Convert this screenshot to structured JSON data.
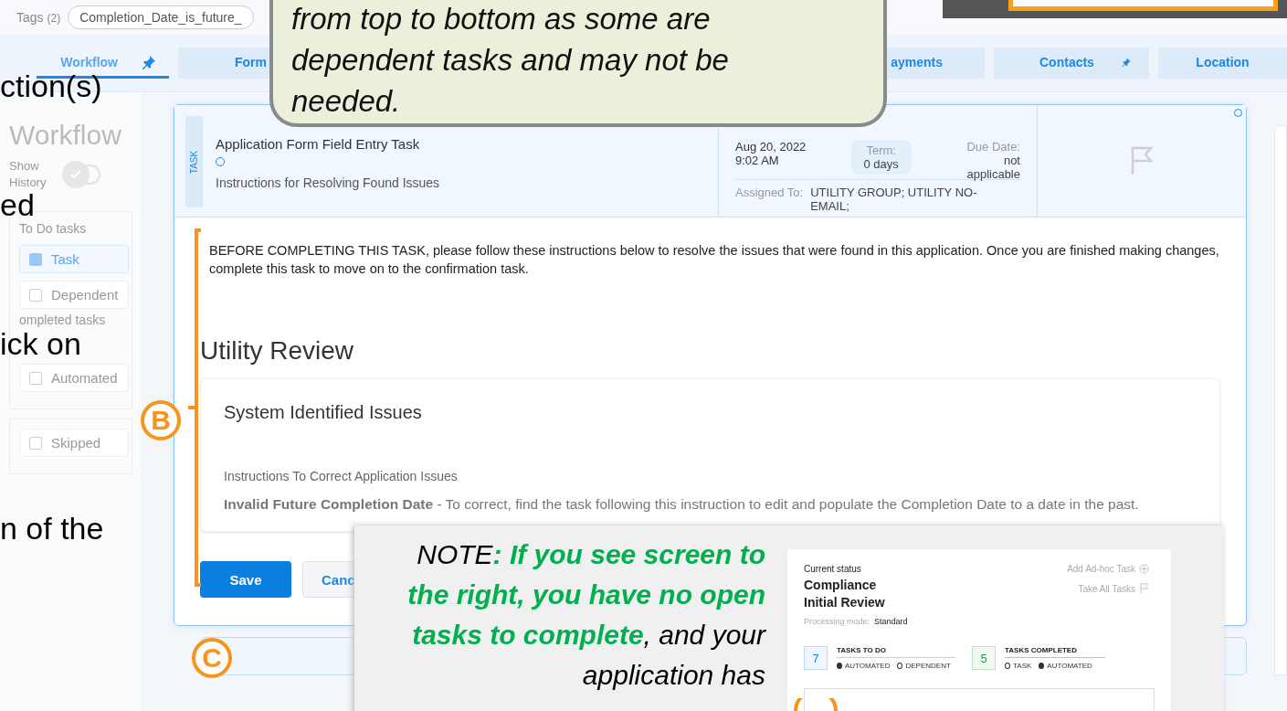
{
  "slide_text": [
    "ction(s)",
    "ed",
    "ick on",
    "n of the"
  ],
  "tags": {
    "label": "Tags",
    "count": "(2)",
    "chip": "Completion_Date_is_future_"
  },
  "tabs": [
    {
      "label": "Workflow",
      "selected": true,
      "pinned": true
    },
    {
      "label": "Form",
      "selected": false
    },
    {
      "label": "ayments",
      "selected": false
    },
    {
      "label": "Contacts",
      "selected": false,
      "pinned": true
    },
    {
      "label": "Location",
      "selected": false,
      "pinned": false
    }
  ],
  "workflow_panel": {
    "title": "Workflow",
    "show_history_label": "Show History",
    "show_history": false,
    "todo_heading": "To Do tasks",
    "todo": [
      {
        "label": "Task",
        "checked": true
      },
      {
        "label": "Dependent",
        "checked": false
      }
    ],
    "completed_heading": "ompleted tasks",
    "completed": [
      {
        "label": "Automated",
        "checked": false
      }
    ],
    "other": [
      {
        "label": "Skipped",
        "checked": false
      }
    ]
  },
  "task": {
    "badge": "TASK",
    "title": "Application Form Field Entry Task",
    "subtitle": "Instructions for Resolving Found Issues",
    "date": "Aug 20, 2022",
    "time": "9:02 AM",
    "term_label": "Term:",
    "term": "0 days",
    "due_label": "Due Date:",
    "due": "not applicable",
    "assigned_label": "Assigned To:",
    "assigned": "UTILITY GROUP; UTILITY NO-EMAIL;"
  },
  "body": {
    "intro": "BEFORE COMPLETING THIS TASK, please follow these instructions below to resolve the issues that were found in this application. Once you are finished making changes, complete this task to move on to the confirmation task.",
    "heading": "Utility Review",
    "issues_title": "System Identified Issues",
    "instructions_label": "Instructions To Correct Application Issues",
    "issue": "**Invalid Future Completion Date** - To correct, find the task following this instruction to edit and populate the Completion Date to a date in the past."
  },
  "buttons": [
    {
      "label": "Save",
      "kind": "primary"
    },
    {
      "label": "Canc",
      "kind": "secondary"
    }
  ],
  "markers": [
    "B",
    "C"
  ],
  "callout": {
    "text": "from top to bottom as some are dependent tasks and may not be needed."
  },
  "note": {
    "parts": [
      {
        "text": "NOTE",
        "emphasis": false
      },
      {
        "text": ": If you see screen to the right, you have no open tasks to complete",
        "emphasis": true
      },
      {
        "text": ", and your application has",
        "emphasis": false
      }
    ]
  },
  "status_panel": {
    "label": "Current status",
    "status": "Compliance Initial Review",
    "mode_label": "Processing mode:",
    "mode": "Standard",
    "add_task": "Add Ad-hoc Task",
    "take_all": "Take All Tasks",
    "groups": [
      {
        "kind": "todo",
        "count": "7",
        "label": "TASKS TO DO",
        "legend": [
          {
            "label": "AUTOMATED",
            "filled": true
          },
          {
            "label": "DEPENDENT",
            "filled": false
          }
        ]
      },
      {
        "kind": "done",
        "count": "5",
        "label": "TASKS COMPLETED",
        "legend": [
          {
            "label": "TASK",
            "filled": false
          },
          {
            "label": "AUTOMATED",
            "filled": true
          }
        ]
      }
    ]
  }
}
